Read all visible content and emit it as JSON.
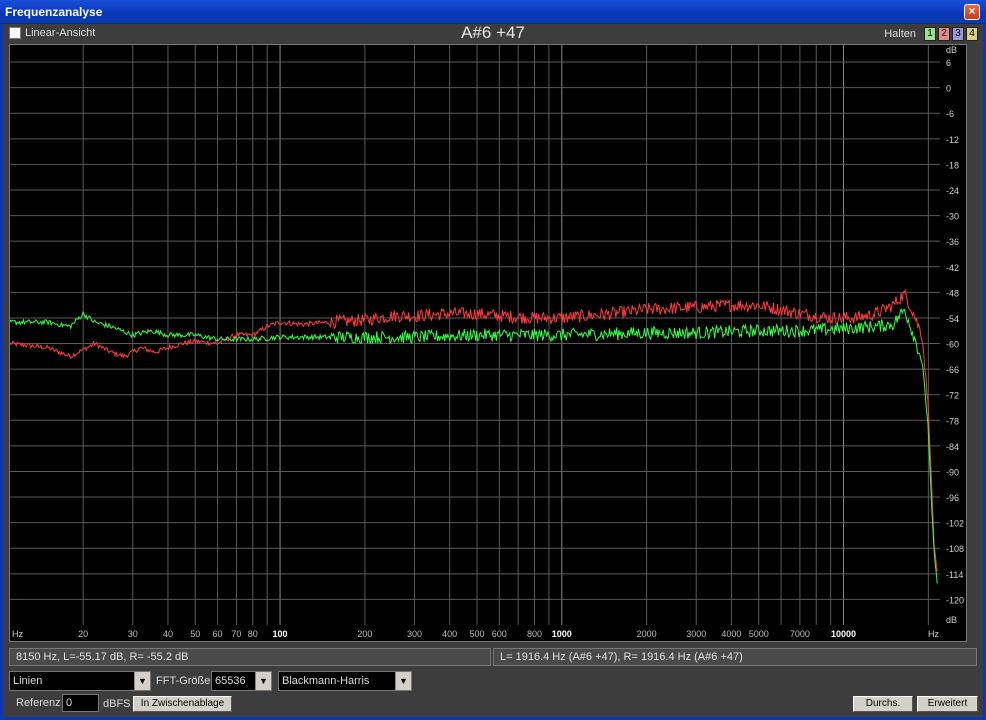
{
  "window": {
    "title": "Frequenzanalyse",
    "close_glyph": "×"
  },
  "header": {
    "linear_view_label": "Linear-Ansicht",
    "linear_view_checked": false,
    "note": "A#6 +47",
    "hold_label": "Halten",
    "hold_buttons": [
      {
        "label": "1",
        "color": "#9be08a"
      },
      {
        "label": "2",
        "color": "#e88a8a"
      },
      {
        "label": "3",
        "color": "#9a9ad8"
      },
      {
        "label": "4",
        "color": "#d8d08a"
      }
    ]
  },
  "chart_data": {
    "type": "line",
    "x_scale": "log",
    "xlim": [
      11,
      22000
    ],
    "ylim": [
      -126,
      10
    ],
    "x_unit_label": "Hz",
    "y_unit_label": "dB",
    "x_tick_labels": [
      {
        "v": 20,
        "t": "20"
      },
      {
        "v": 30,
        "t": "30"
      },
      {
        "v": 40,
        "t": "40"
      },
      {
        "v": 50,
        "t": "50"
      },
      {
        "v": 60,
        "t": "60"
      },
      {
        "v": 70,
        "t": "70"
      },
      {
        "v": 80,
        "t": "80"
      },
      {
        "v": 100,
        "t": "100"
      },
      {
        "v": 200,
        "t": "200"
      },
      {
        "v": 300,
        "t": "300"
      },
      {
        "v": 400,
        "t": "400"
      },
      {
        "v": 500,
        "t": "500"
      },
      {
        "v": 600,
        "t": "600"
      },
      {
        "v": 800,
        "t": "800"
      },
      {
        "v": 1000,
        "t": "1000"
      },
      {
        "v": 2000,
        "t": "2000"
      },
      {
        "v": 3000,
        "t": "3000"
      },
      {
        "v": 4000,
        "t": "4000"
      },
      {
        "v": 5000,
        "t": "5000"
      },
      {
        "v": 7000,
        "t": "7000"
      },
      {
        "v": 10000,
        "t": "10000"
      }
    ],
    "y_ticks": [
      6,
      0,
      -6,
      -12,
      -18,
      -24,
      -30,
      -36,
      -42,
      -48,
      -54,
      -60,
      -66,
      -72,
      -78,
      -84,
      -90,
      -96,
      -102,
      -108,
      -114,
      -120
    ],
    "grid": true,
    "series": [
      {
        "color": "#ff3b3b",
        "x": [
          11,
          15,
          18,
          22,
          25,
          28,
          32,
          36,
          40,
          45,
          50,
          60,
          70,
          80,
          90,
          100,
          120,
          150,
          200,
          250,
          300,
          400,
          500,
          600,
          800,
          1000,
          1500,
          2000,
          3000,
          4000,
          5000,
          7000,
          9000,
          11000,
          13000,
          15000,
          16000,
          16500,
          17500,
          19000,
          20000,
          20500,
          21000,
          21500
        ],
        "y": [
          -60,
          -61,
          -63,
          -60,
          -62,
          -63,
          -61,
          -62,
          -61,
          -60,
          -59.5,
          -60,
          -58,
          -58,
          -56,
          -55,
          -55.5,
          -55,
          -54.5,
          -53.5,
          -53.5,
          -53,
          -53,
          -53.5,
          -54,
          -54,
          -53,
          -52,
          -51.5,
          -51,
          -51,
          -53,
          -54,
          -54,
          -53,
          -51,
          -49,
          -48.5,
          -52,
          -58,
          -75,
          -92,
          -108,
          -114
        ]
      },
      {
        "color": "#33ff44",
        "x": [
          11,
          15,
          18,
          20,
          22,
          25,
          30,
          35,
          40,
          50,
          60,
          80,
          100,
          150,
          200,
          300,
          500,
          800,
          1000,
          2000,
          3000,
          5000,
          7000,
          10000,
          13000,
          15000,
          16000,
          16500,
          17500,
          19000,
          20000,
          20500,
          21000,
          21500
        ],
        "y": [
          -55,
          -55,
          -56,
          -53,
          -55,
          -56,
          -58,
          -57,
          -58,
          -58,
          -59,
          -59,
          -58.5,
          -58.5,
          -58.5,
          -58.5,
          -58,
          -58,
          -58,
          -57.5,
          -57.5,
          -57,
          -57,
          -56.5,
          -56,
          -55.5,
          -53,
          -52,
          -57,
          -64,
          -80,
          -97,
          -110,
          -116
        ]
      }
    ]
  },
  "status": {
    "cursor_readout": "8150 Hz, L=-55.17 dB, R= -55.2 dB",
    "peak_readout": "L= 1916.4 Hz (A#6 +47), R= 1916.4 Hz (A#6 +47)"
  },
  "controls": {
    "mode_select": "Linien",
    "fft_label": "FFT-Größe",
    "fft_size": "65536",
    "window_select": "Blackmann-Harris",
    "arrow_glyph": "▼",
    "reference_label": "Referenz",
    "reference_value": "0",
    "dbfs_label": "dBFS",
    "clipboard_button": "In Zwischenablage",
    "average_button": "Durchs.",
    "advanced_button": "Erweitert"
  }
}
